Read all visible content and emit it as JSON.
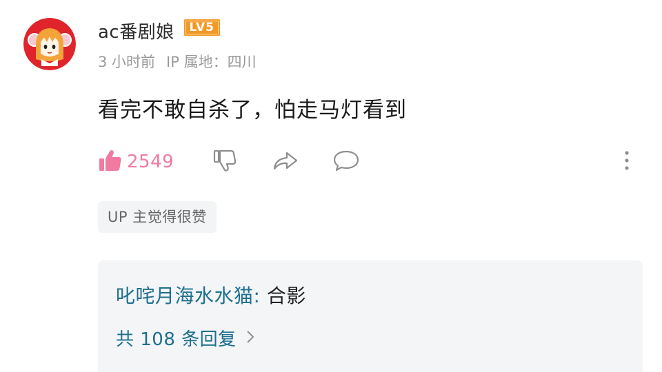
{
  "comment": {
    "username": "ac番剧娘",
    "level_badge": "LV5",
    "time_ago": "3 小时前",
    "ip_location": "IP 属地：四川",
    "text": "看完不敢自杀了，怕走马灯看到",
    "like_count": "2549",
    "tag": "UP 主觉得很赞"
  },
  "replies": {
    "preview_author": "叱咤月海水水猫",
    "preview_separator": ": ",
    "preview_text": "合影",
    "total_label": "共 108 条回复"
  },
  "icons": {
    "like": "thumbs-up-icon",
    "dislike": "thumbs-down-icon",
    "share": "share-icon",
    "reply": "comment-bubble-icon",
    "more": "more-vertical-icon",
    "chevron": "chevron-right-icon"
  },
  "colors": {
    "like_pink": "#f07aa0",
    "level_orange": "#f29a27",
    "reply_link": "#1f6f8e",
    "avatar_red": "#e0242b"
  }
}
